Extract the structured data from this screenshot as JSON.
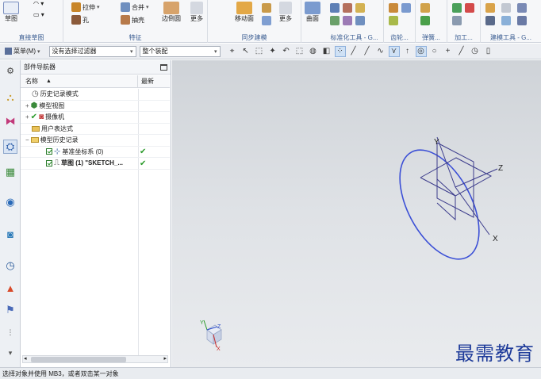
{
  "ribbon": {
    "groups": [
      {
        "label": "直接草图"
      },
      {
        "label": "特征"
      },
      {
        "label": "同步建模"
      },
      {
        "label": "标准化工具 - G..."
      },
      {
        "label": "齿轮..."
      },
      {
        "label": "弹簧..."
      },
      {
        "label": "加工..."
      },
      {
        "label": "建模工具 - G..."
      }
    ],
    "sketch_label": "草图",
    "extrude_label": "拉伸",
    "hole_label": "孔",
    "unite_label": "合并",
    "shell_label": "抽壳",
    "edge_blend_label": "边倒圆",
    "more_label_1": "更多",
    "move_face_label": "移动面",
    "more_label_2": "更多",
    "surface_label": "曲面"
  },
  "toolbar": {
    "menu_label": "菜单(M)",
    "filter_value": "没有选择过滤器",
    "scope_value": "整个装配"
  },
  "navigator": {
    "title": "部件导航器",
    "col_name": "名称",
    "col_new": "最新",
    "rows": [
      {
        "label": "历史记录模式"
      },
      {
        "label": "模型视图"
      },
      {
        "label": "摄像机"
      },
      {
        "label": "用户表达式"
      },
      {
        "label": "模型历史记录"
      },
      {
        "label": "基准坐标系 (0)"
      },
      {
        "label": "草图 (1) \"SKETCH_..."
      }
    ]
  },
  "graphics": {
    "axis_x": "X",
    "axis_y": "Y",
    "axis_z": "Z",
    "mini_x": "X",
    "mini_y": "Y",
    "mini_z": "Z",
    "watermark": "最需教育"
  },
  "status": {
    "text": "选择对象并使用 MB3，或者双击某一对象"
  },
  "colors": {
    "ellipse": "#3b4fd6",
    "triad": "#3c3c8c",
    "label_blue": "#3d5f93"
  }
}
